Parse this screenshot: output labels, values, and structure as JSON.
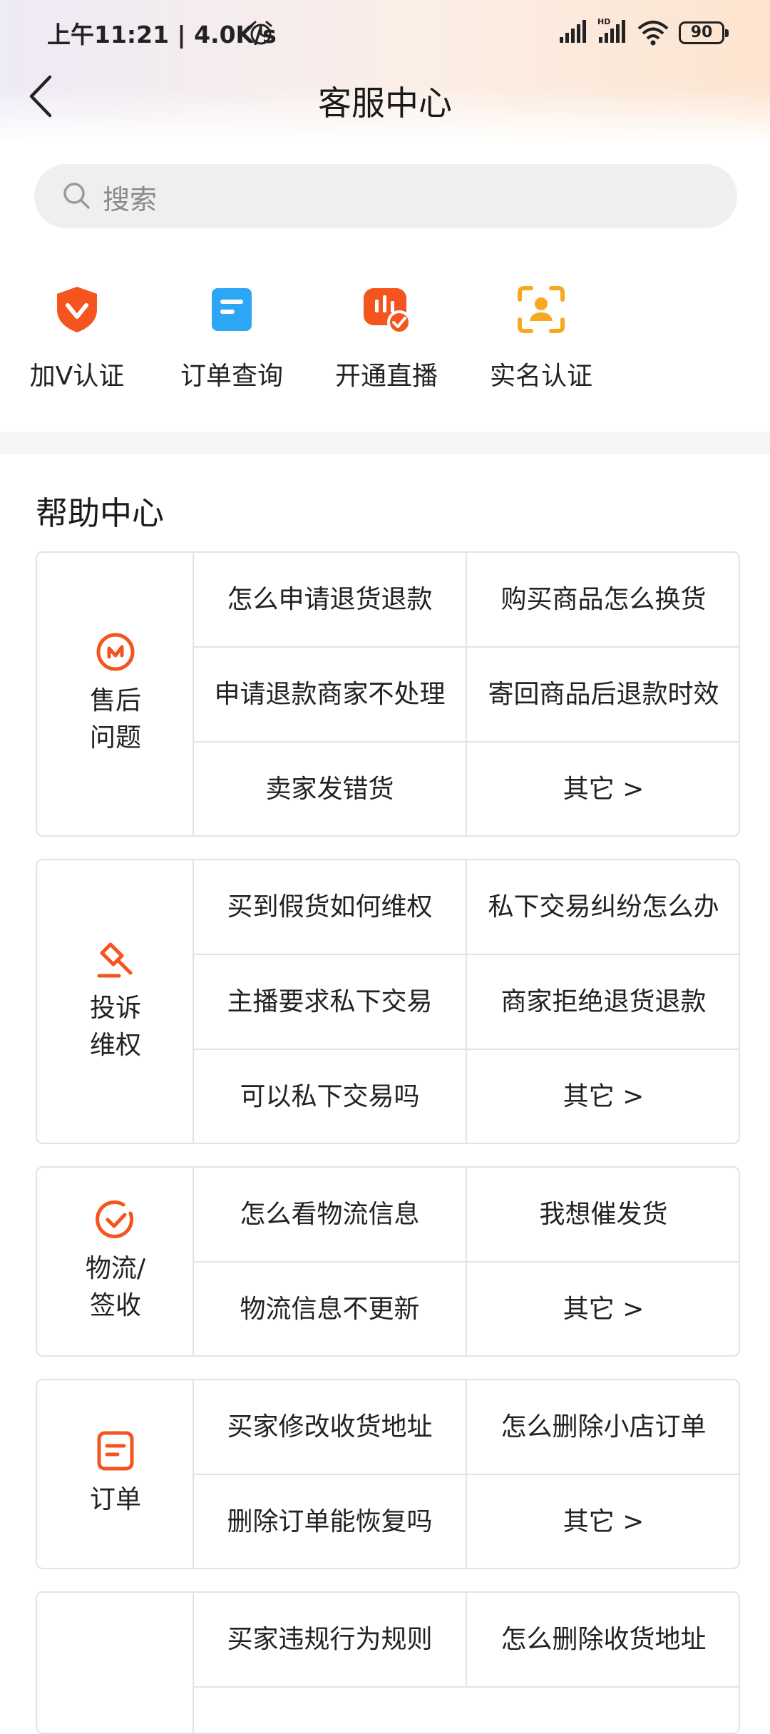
{
  "status_bar": {
    "time": "上午11:21 | 4.0K/s",
    "battery": "90"
  },
  "nav": {
    "title": "客服中心"
  },
  "search": {
    "placeholder": "搜索"
  },
  "quick_actions": [
    {
      "label": "加V认证",
      "icon": "v-badge-icon"
    },
    {
      "label": "订单查询",
      "icon": "document-icon"
    },
    {
      "label": "开通直播",
      "icon": "live-stream-icon"
    },
    {
      "label": "实名认证",
      "icon": "face-scan-icon"
    }
  ],
  "help_center": {
    "title": "帮助中心",
    "categories": [
      {
        "label_line1": "售后",
        "label_line2": "问题",
        "icon": "after-sales-icon",
        "questions": [
          [
            "怎么申请退货退款",
            "购买商品怎么换货"
          ],
          [
            "申请退款商家不处理",
            "寄回商品后退款时效"
          ],
          [
            "卖家发错货",
            "其它 >"
          ]
        ]
      },
      {
        "label_line1": "投诉",
        "label_line2": "维权",
        "icon": "gavel-icon",
        "questions": [
          [
            "买到假货如何维权",
            "私下交易纠纷怎么办"
          ],
          [
            "主播要求私下交易",
            "商家拒绝退货退款"
          ],
          [
            "可以私下交易吗",
            "其它 >"
          ]
        ]
      },
      {
        "label_line1": "物流/",
        "label_line2": "签收",
        "icon": "check-circle-icon",
        "questions": [
          [
            "怎么看物流信息",
            "我想催发货"
          ],
          [
            "物流信息不更新",
            "其它 >"
          ]
        ]
      },
      {
        "label_line1": "订单",
        "label_line2": "",
        "icon": "order-icon",
        "questions": [
          [
            "买家修改收货地址",
            "怎么删除小店订单"
          ],
          [
            "删除订单能恢复吗",
            "其它 >"
          ]
        ]
      },
      {
        "label_line1": "",
        "label_line2": "",
        "icon": "",
        "questions": [
          [
            "买家违规行为规则",
            "怎么删除收货地址"
          ]
        ]
      }
    ]
  },
  "colors": {
    "accent_orange": "#f4541d",
    "blue": "#2ea6f6",
    "yellow": "#f7a823"
  }
}
